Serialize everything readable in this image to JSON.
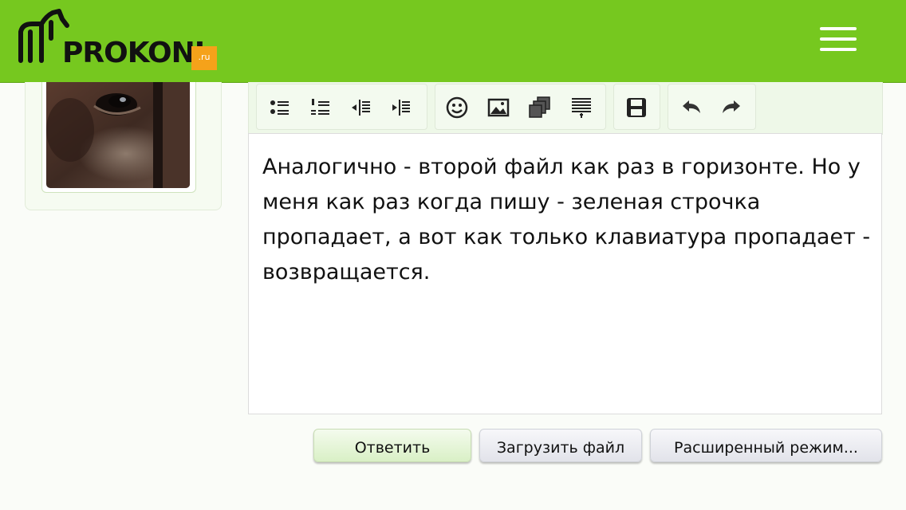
{
  "header": {
    "logo_text": "PROKONI",
    "logo_domain": ".ru",
    "brand_color": "#76c81f",
    "menu_icon": "hamburger-icon"
  },
  "sidebar": {
    "avatar": "horse-eye-avatar"
  },
  "toolbar": {
    "groups": [
      [
        "bulleted-list-icon",
        "numbered-list-icon",
        "outdent-icon",
        "indent-icon"
      ],
      [
        "smiley-icon",
        "image-icon",
        "media-gallery-icon",
        "insert-template-icon"
      ],
      [
        "save-icon"
      ],
      [
        "undo-icon",
        "redo-icon"
      ]
    ]
  },
  "editor": {
    "text": "Аналогично - второй файл как раз в горизонте. Но у меня как раз когда пишу - зеленая строчка пропадает, а вот как только клавиатура пропадает - возвращается."
  },
  "actions": {
    "reply_label": "Ответить",
    "upload_label": "Загрузить файл",
    "advanced_label": "Расширенный режим..."
  }
}
